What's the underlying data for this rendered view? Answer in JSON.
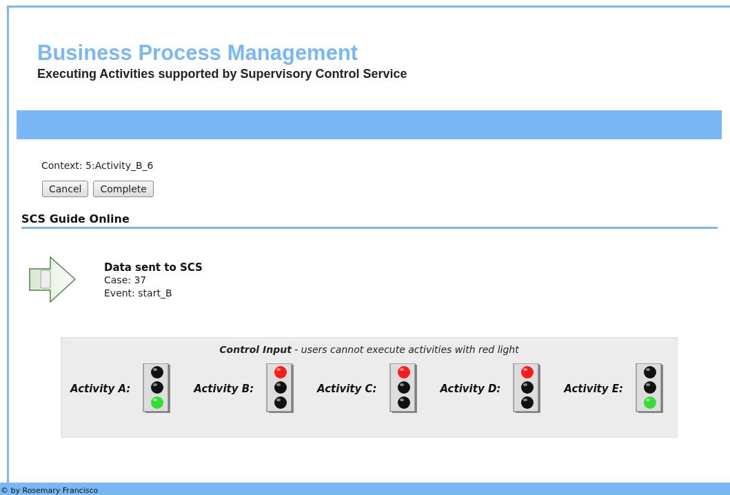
{
  "header": {
    "title": "Business Process Management",
    "subtitle": "Executing Activities supported by Supervisory Control Service"
  },
  "context": "Context: 5:Activity_B_6",
  "buttons": [
    "Cancel",
    "Complete"
  ],
  "section_title": "SCS Guide Online",
  "message": {
    "title": "Data sent to SCS",
    "lines": [
      "Case: 37",
      "Event: start_B"
    ]
  },
  "control_input": {
    "caption": "**Control Input** - users cannot execute activities with red light",
    "activities": [
      {
        "label": "Activity A:",
        "kind": "go",
        "color": "#33dd33"
      },
      {
        "label": "Activity B:",
        "kind": "stop",
        "color": "#ff1a1a"
      },
      {
        "label": "Activity C:",
        "kind": "stop",
        "color": "#ff1a1a"
      },
      {
        "label": "Activity D:",
        "kind": "stop",
        "color": "#ff1a1a"
      },
      {
        "label": "Activity E:",
        "kind": "go",
        "color": "#33dd33"
      }
    ]
  },
  "footer": "© by Rosemary Francisco"
}
